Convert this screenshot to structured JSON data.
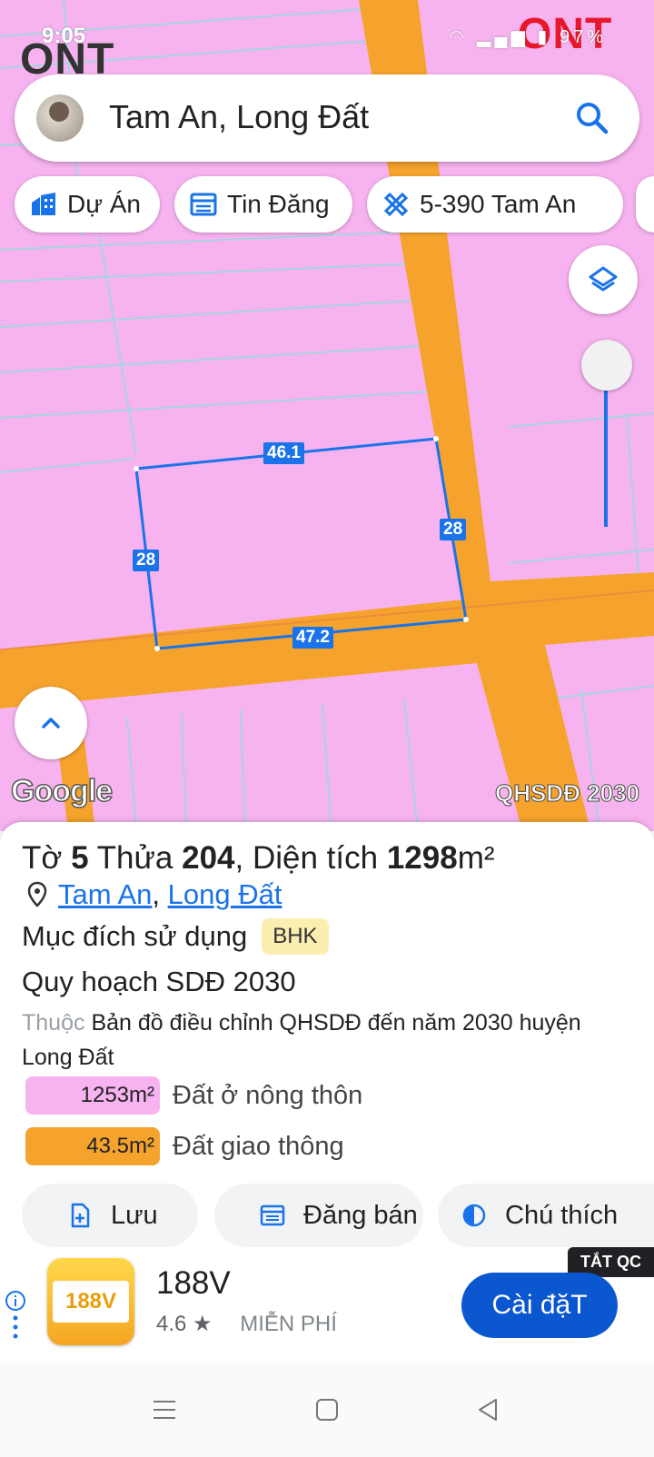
{
  "status_bar": {
    "time": "9:05",
    "battery": "97%"
  },
  "map": {
    "zone_label_left": "ONT",
    "zone_label_right": "ONT",
    "google_logo": "Google",
    "plan_label": "QHSDĐ 2030",
    "parcel_dimensions": {
      "top": "46.1",
      "right": "28",
      "bottom": "47.2",
      "left": "28"
    },
    "colors": {
      "residential": "#f7b3f0",
      "traffic": "#f5a32c",
      "boundary": "#1a73e8"
    }
  },
  "search": {
    "query": "Tam An, Long Đất",
    "icon": "search-icon"
  },
  "chips": [
    {
      "label": "Dự Án",
      "icon": "building-icon"
    },
    {
      "label": "Tin Đăng",
      "icon": "listing-icon"
    },
    {
      "label": "5-390 Tam An",
      "icon": "ruler-icon"
    }
  ],
  "parcel": {
    "sheet_prefix": "Tờ",
    "sheet_number": "5",
    "lot_prefix": "Thửa",
    "lot_number": "204",
    "area_prefix": ", Diện tích",
    "area_value": "1298",
    "area_unit": "m²",
    "ward": "Tam An",
    "district": "Long Đất",
    "purpose_label": "Mục đích sử dụng",
    "purpose_code": "BHK",
    "plan_title": "Quy hoạch SDĐ 2030",
    "plan_desc_muted": "Thuộc",
    "plan_desc": "Bản đồ điều chỉnh QHSDĐ đến năm 2030 huyện Long Đất",
    "areas": [
      {
        "value": "1253m²",
        "label": "Đất ở nông thôn",
        "color": "#f7b3f0"
      },
      {
        "value": "43.5m²",
        "label": "Đất giao thông",
        "color": "#f5a32c"
      }
    ]
  },
  "actions": [
    {
      "label": "Lưu",
      "icon": "save-file-icon"
    },
    {
      "label": "Đăng bán",
      "icon": "post-listing-icon"
    },
    {
      "label": "Chú thích",
      "icon": "legend-contrast-icon"
    }
  ],
  "ad": {
    "close_label": "TẮT QC",
    "app_name": "188V",
    "app_icon_text": "188V",
    "rating": "4.6 ★",
    "price": "MIỄN PHÍ",
    "install_label": "Cài đặT"
  }
}
